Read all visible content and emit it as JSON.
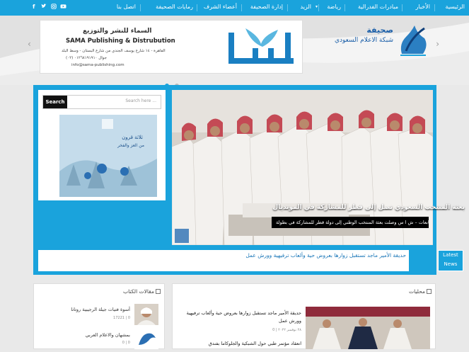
{
  "nav": {
    "items": [
      "الرئيسية",
      "الأخبار",
      "مبادرات الفدرالية",
      "رياضة",
      "الزيد",
      "إدارة الصحيفة",
      "أعضاء الشرف",
      "رمايات الصحيفة",
      "اتصل بنا"
    ],
    "social_icons": [
      "facebook-icon",
      "twitter-icon",
      "instagram-icon",
      "youtube-icon"
    ]
  },
  "logo": {
    "line1": "صحيفة",
    "line2": "شبكة الاعلام السعودي"
  },
  "banner": {
    "arabic_brand": "سما",
    "name_ar": "السماء للنشر والتوزيع",
    "name_en": "SAMA Publishing & Distrubution",
    "address": "القاهرة - ١٤ شارع يوسف الجندي من شارع البستان - وسط البلد",
    "phone": "جوال ٠١٢٦٨١٩١٩١٠ (٠٢)",
    "email": "info@sama-publishing.com"
  },
  "search": {
    "button": "Search",
    "placeholder": "Search here ..."
  },
  "ad": {
    "text1": "ثلاثة قرون",
    "text2": "من العز والفخر"
  },
  "featured": {
    "title": "بعثة المنتخب السعودي تصل إلى قطر للمشاركة في المونديال",
    "caption": "متابعات – ش ا س وصلت بعثة المنتخب الوطني إلى دولة قطر للمشاركة في بطولة [...]"
  },
  "ticker": {
    "label_line1": "Latest",
    "label_line2": "News",
    "headline": "حديقة الأمير ماجد تستقبل زوارها بعروض حية وألعاب ترفيهية وورش عمل"
  },
  "local": {
    "title": "محليات",
    "item1_title": "حديقة الأمير ماجد تستقبل زوارها بعروض حية وألعاب ترفيهية وورش عمل",
    "item1_meta": "٢٨ نوفمبر ٢٠٢٢  |  0",
    "item2_title": "انعقاد مؤتمر طبي حول الشبكية والجلوكاما بفندق"
  },
  "writers": {
    "title": "مقالات الكتاب",
    "item1_title": "أسوة فتيات جيلة الرجيبية روتانا",
    "item1_meta": "17221 | 0",
    "item2_title": "بمشهان والاعلام العربي",
    "item2_meta": "0 | 0"
  },
  "colors": {
    "brand_blue": "#1aa3dc",
    "dark": "#111111"
  }
}
